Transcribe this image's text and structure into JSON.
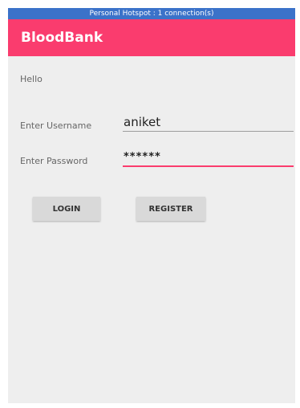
{
  "status_bar": {
    "text": "Personal Hotspot : 1 connection(s)"
  },
  "app_bar": {
    "title": "BloodBank"
  },
  "main": {
    "greeting": "Hello",
    "username_label": "Enter Username",
    "username_value": "aniket",
    "password_label": "Enter Password",
    "password_display": "******",
    "login_label": "LOGIN",
    "register_label": "REGISTER"
  },
  "colors": {
    "accent": "#fa3c6e",
    "status_bar": "#3b72c9",
    "background": "#eeeeee"
  }
}
